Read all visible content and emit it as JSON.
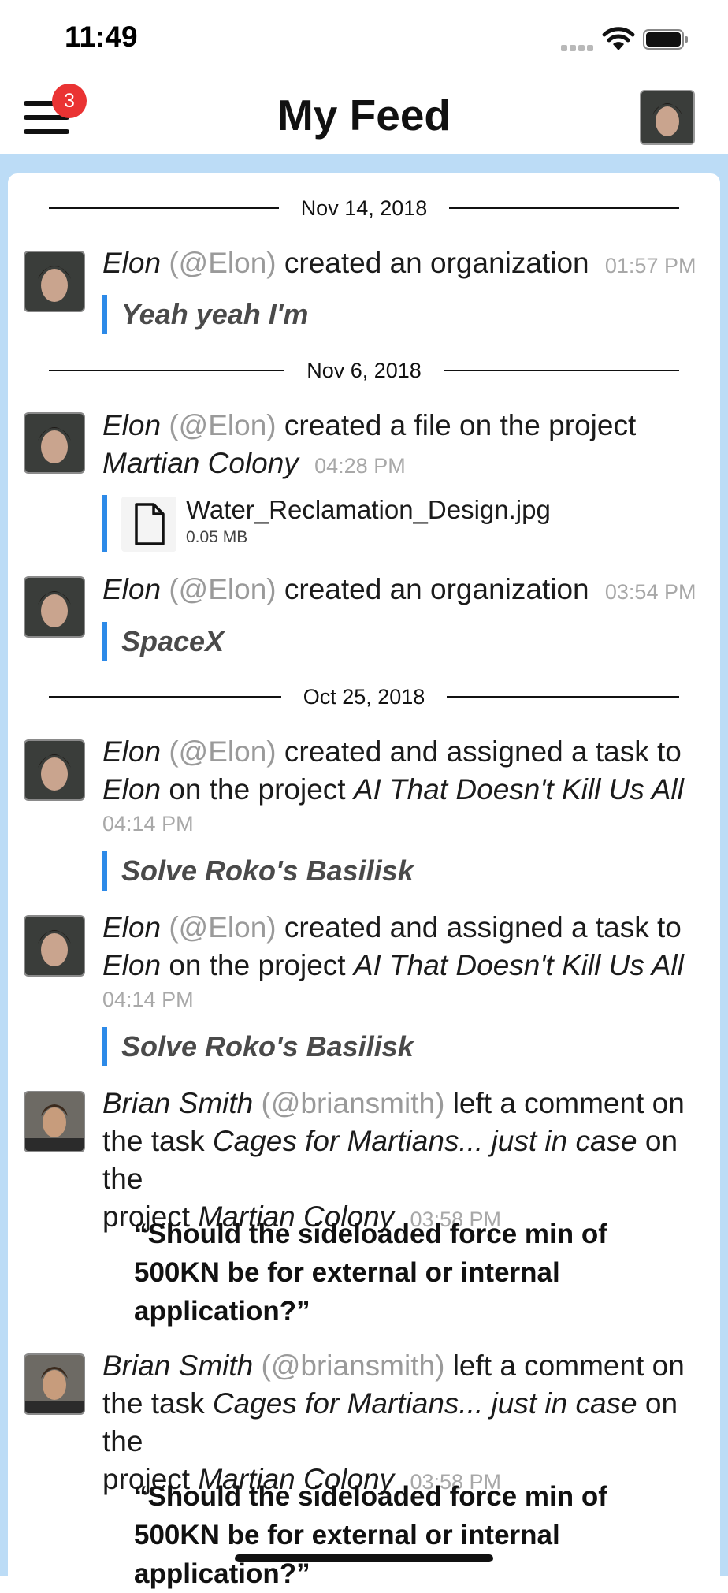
{
  "status_bar": {
    "time": "11:49"
  },
  "header": {
    "title": "My Feed",
    "notification_count": "3"
  },
  "feed": {
    "groups": [
      {
        "date": "Nov 14, 2018"
      },
      {
        "date": "Nov 6, 2018"
      },
      {
        "date": "Oct 25, 2018"
      }
    ],
    "entries": [
      {
        "actor": "Elon",
        "handle": "(@Elon)",
        "action": "created an organization",
        "time": "01:57 PM",
        "quote": "Yeah yeah I'm"
      },
      {
        "actor": "Elon",
        "handle": "(@Elon)",
        "action": "created a file on the project",
        "project": "Martian Colony",
        "time": "04:28 PM",
        "file": {
          "name": "Water_Reclamation_Design.jpg",
          "size": "0.05 MB"
        }
      },
      {
        "actor": "Elon",
        "handle": "(@Elon)",
        "action": "created an organization",
        "time": "03:54 PM",
        "quote": "SpaceX"
      },
      {
        "actor": "Elon",
        "handle": "(@Elon)",
        "action": "created and assigned a task to",
        "assignee": "Elon",
        "connector": "on the project",
        "project": "AI That Doesn't Kill Us All",
        "time": "04:14 PM",
        "quote": "Solve Roko's Basilisk"
      },
      {
        "actor": "Elon",
        "handle": "(@Elon)",
        "action": "created and assigned a task to",
        "assignee": "Elon",
        "connector": "on the project",
        "project": "AI That Doesn't Kill Us All",
        "time": "04:14 PM",
        "quote": "Solve Roko's Basilisk"
      },
      {
        "actor": "Brian Smith",
        "handle": "(@briansmith)",
        "action": "left a comment on",
        "task_prefix": "the task",
        "task": "Cages for Martians... just in case",
        "connector": "on the",
        "project_prefix": "project",
        "project": "Martian Colony",
        "time": "03:58 PM",
        "comment": "“Should the sideloaded force min of 500KN be for external or internal application?”"
      },
      {
        "actor": "Brian Smith",
        "handle": "(@briansmith)",
        "action": "left a comment on",
        "task_prefix": "the task",
        "task": "Cages for Martians... just in case",
        "connector": "on the",
        "project_prefix": "project",
        "project": "Martian Colony",
        "time": "03:58 PM",
        "comment": "“Should the sideloaded force min of 500KN be for external or internal application?”"
      }
    ]
  },
  "colors": {
    "accent": "#2d8ae8",
    "feed_background": "#bcdcf6",
    "badge": "#ea3333"
  }
}
